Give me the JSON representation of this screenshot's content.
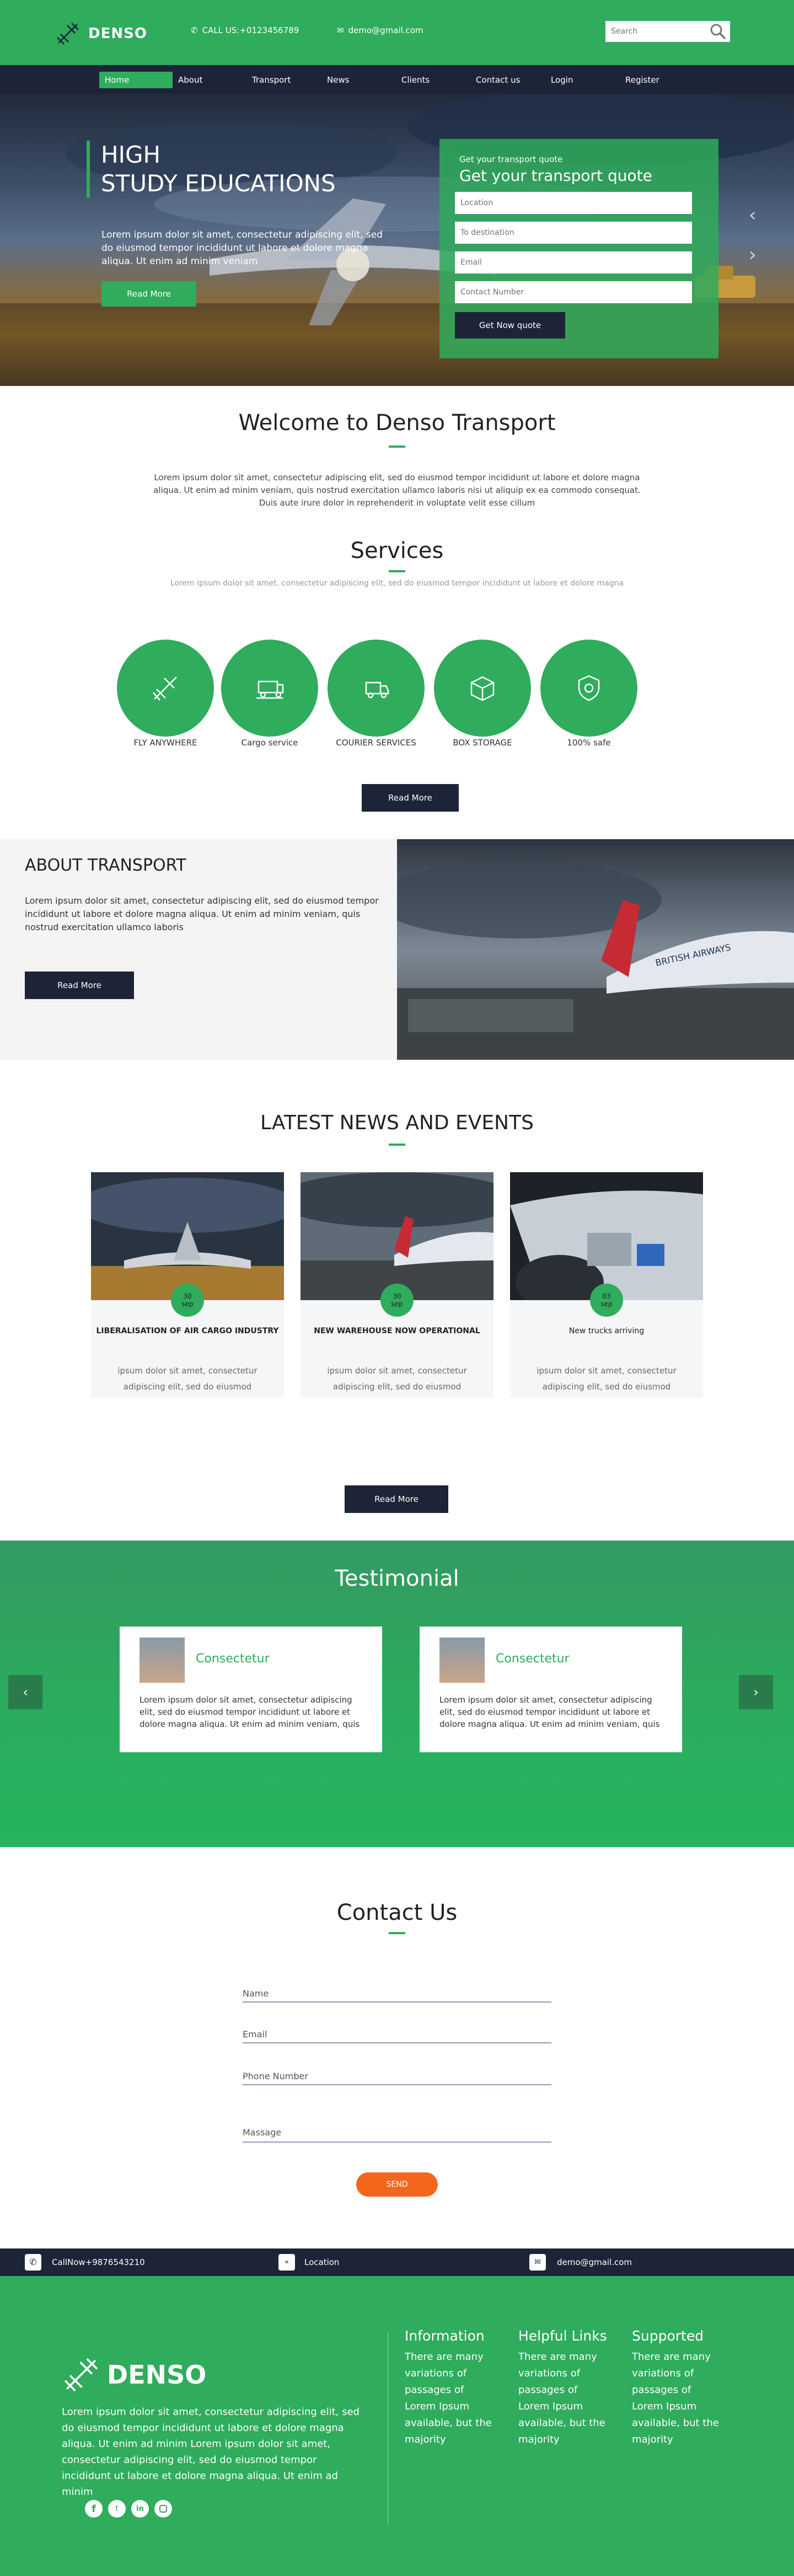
{
  "header": {
    "logo": "DENSO",
    "phone": "CALL US:+0123456789",
    "email": "demo@gmail.com",
    "search_placeholder": "Search"
  },
  "nav": {
    "items": [
      "Home",
      "About",
      "Transport",
      "News",
      "Clients",
      "Contact us",
      "Login",
      "Register"
    ],
    "active": "Home"
  },
  "hero": {
    "heading_line1": "HIGH",
    "heading_line2": "STUDY EDUCATIONS",
    "text": "Lorem ipsum dolor sit amet, consectetur adipiscing elit, sed do eiusmod tempor incididunt ut labore et dolore magna aliqua. Ut enim ad minim veniam",
    "button": "Read More",
    "quote_small": "Get your transport quote",
    "quote_title": "Get your transport quote",
    "fields": [
      "Location",
      "To destination",
      "Email",
      "Contact Number"
    ],
    "submit": "Get Now quote",
    "prev_arrow": "‹",
    "next_arrow": "›"
  },
  "welcome": {
    "title": "Welcome to Denso Transport",
    "text": "Lorem ipsum dolor sit amet, consectetur adipiscing elit, sed do eiusmod tempor incididunt ut labore et dolore magna aliqua. Ut enim ad minim veniam, quis nostrud exercitation ullamco laboris nisi ut aliquip ex ea commodo consequat. Duis aute irure dolor in reprehenderit in voluptate velit esse cillum"
  },
  "services": {
    "title": "Services",
    "subtitle": "Lorem ipsum dolor sit amet, consectetur adipiscing elit, sed do eiusmod tempor incididunt ut labore et dolore magna",
    "items": [
      {
        "label": "FLY ANYWHERE",
        "icon": "plane-icon"
      },
      {
        "label": "Cargo service",
        "icon": "cargo-truck-icon"
      },
      {
        "label": "COURIER SERVICES",
        "icon": "delivery-truck-icon"
      },
      {
        "label": "BOX STORAGE",
        "icon": "box-icon"
      },
      {
        "label": "100% safe",
        "icon": "shield-icon"
      }
    ],
    "button": "Read More"
  },
  "about": {
    "title": "ABOUT TRANSPORT",
    "text": "Lorem ipsum dolor sit amet, consectetur adipiscing elit, sed do eiusmod tempor incididunt ut labore et dolore magna aliqua. Ut enim ad minim veniam, quis nostrud exercitation ullamco laboris",
    "button": "Read More",
    "image_text": "BRITISH AIRWAYS"
  },
  "news": {
    "title": "LATEST NEWS AND EVENTS",
    "items": [
      {
        "day": "30",
        "month": "sep",
        "title": "LIBERALISATION OF AIR CARGO INDUSTRY",
        "text": "ipsum dolor sit amet, consectetur adipiscing elit, sed do eiusmod tempor incididunt ut labore et dolore magna aliqua. ion ullamco laboris nisi ut aliquip ex ea commodo consequat. Duis aute"
      },
      {
        "day": "30",
        "month": "sep",
        "title": "NEW WAREHOUSE NOW OPERATIONAL",
        "text": "ipsum dolor sit amet, consectetur adipiscing elit, sed do eiusmod tempor incididunt ut labore et dolore magna aliqua. ion ullamco laboris nisi ut aliquip ex ea commodo consequat. Duis aute"
      },
      {
        "day": "03",
        "month": "sep",
        "title": "New trucks arriving",
        "text": "ipsum dolor sit amet, consectetur adipiscing elit, sed do eiusmod tempor incididunt ut labore et dolore magna aliqua. ion ullamco laboris nisi ut aliquip ex ea commodo consequat. Duis aute"
      }
    ],
    "button": "Read More"
  },
  "testimonial": {
    "title": "Testimonial",
    "items": [
      {
        "name": "Consectetur",
        "text": "Lorem ipsum dolor sit amet, consectetur adipiscing elit, sed do eiusmod tempor incididunt ut labore et dolore magna aliqua. Ut enim ad minim veniam, quis"
      },
      {
        "name": "Consectetur",
        "text": "Lorem ipsum dolor sit amet, consectetur adipiscing elit, sed do eiusmod tempor incididunt ut labore et dolore magna aliqua. Ut enim ad minim veniam, quis"
      }
    ],
    "prev_arrow": "‹",
    "next_arrow": "›"
  },
  "contact": {
    "title": "Contact Us",
    "fields": [
      "Name",
      "Email",
      "Phone Number",
      "Massage"
    ],
    "submit": "SEND"
  },
  "infobar": {
    "phone": "CallNow+9876543210",
    "location": "Location",
    "email": "demo@gmail.com"
  },
  "footer": {
    "logo": "DENSO",
    "text": "Lorem ipsum dolor sit amet, consectetur adipiscing elit, sed do eiusmod tempor incididunt ut labore et dolore magna aliqua. Ut enim ad minim Lorem ipsum dolor sit amet, consectetur adipiscing elit, sed do eiusmod tempor incididunt ut labore et dolore magna aliqua. Ut enim ad minim",
    "columns": [
      {
        "title": "Information",
        "text": "There are many variations of passages of Lorem Ipsum available, but the majority"
      },
      {
        "title": "Helpful Links",
        "text": "There are many variations of passages of Lorem Ipsum available, but the majority"
      },
      {
        "title": "Supported",
        "text": "There are many variations of passages of Lorem Ipsum available, but the majority"
      }
    ],
    "social": [
      "facebook-icon",
      "twitter-icon",
      "linkedin-icon",
      "instagram-icon"
    ]
  },
  "colors": {
    "green": "#2fac5c",
    "navy": "#1e2437",
    "orange": "#f5661d"
  }
}
